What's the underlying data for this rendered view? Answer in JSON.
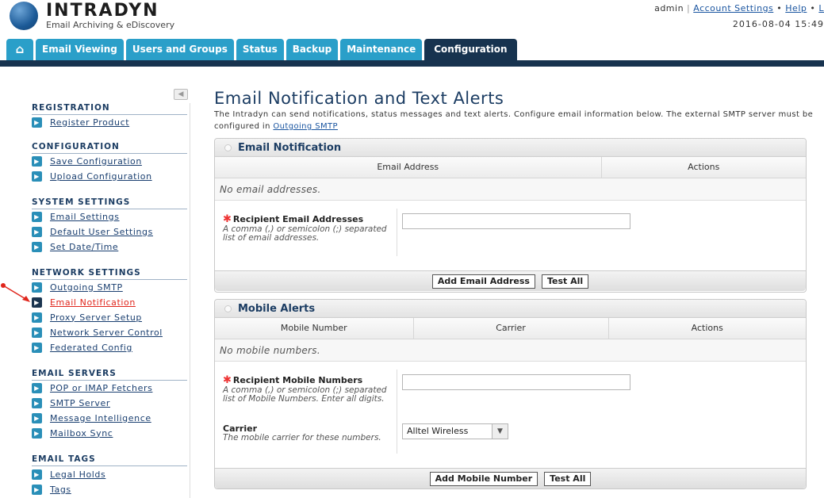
{
  "header": {
    "brand": "INTRADYN",
    "tagline": "Email Archiving & eDiscovery",
    "user": "admin",
    "account_settings": "Account Settings",
    "help": "Help",
    "logout": "L",
    "datetime": "2016-08-04 15:49"
  },
  "tabs": [
    {
      "label": "Email Viewing"
    },
    {
      "label": "Users and Groups"
    },
    {
      "label": "Status"
    },
    {
      "label": "Backup"
    },
    {
      "label": "Maintenance"
    },
    {
      "label": "Configuration"
    }
  ],
  "sidebar": {
    "sections": [
      {
        "title": "REGISTRATION",
        "items": [
          "Register Product"
        ]
      },
      {
        "title": "CONFIGURATION",
        "items": [
          "Save Configuration",
          "Upload Configuration"
        ]
      },
      {
        "title": "SYSTEM SETTINGS",
        "items": [
          "Email Settings",
          "Default User Settings",
          "Set Date/Time"
        ]
      },
      {
        "title": "NETWORK SETTINGS",
        "items": [
          "Outgoing SMTP",
          "Email Notification",
          "Proxy Server Setup",
          "Network Server Control",
          "Federated Config"
        ]
      },
      {
        "title": "EMAIL SERVERS",
        "items": [
          "POP or IMAP Fetchers",
          "SMTP Server",
          "Message Intelligence",
          "Mailbox Sync"
        ]
      },
      {
        "title": "EMAIL TAGS",
        "items": [
          "Legal Holds",
          "Tags"
        ]
      }
    ],
    "active_item": "Email Notification"
  },
  "main": {
    "title": "Email Notification and Text Alerts",
    "intro": "The Intradyn can send notifications, status messages and text alerts. Configure email information below. The external SMTP server must be configured in ",
    "intro_link": "Outgoing SMTP",
    "email_panel": {
      "title": "Email Notification",
      "columns": [
        "Email Address",
        "Actions"
      ],
      "empty_text": "No email addresses.",
      "field_label": "Recipient Email Addresses",
      "field_desc": "A comma (,) or semicolon (;) separated list of email addresses.",
      "field_value": "",
      "add_button": "Add Email Address",
      "test_button": "Test All"
    },
    "mobile_panel": {
      "title": "Mobile Alerts",
      "columns": [
        "Mobile Number",
        "Carrier",
        "Actions"
      ],
      "empty_text": "No mobile numbers.",
      "field_label": "Recipient Mobile Numbers",
      "field_desc": "A comma (,) or semicolon (;) separated list of Mobile Numbers. Enter all digits.",
      "field_value": "",
      "carrier_label": "Carrier",
      "carrier_desc": "The mobile carrier for these numbers.",
      "carrier_value": "Alltel Wireless",
      "add_button": "Add Mobile Number",
      "test_button": "Test All"
    }
  },
  "colors": {
    "nav_dark": "#17334f",
    "tab_blue": "#2a9fc9",
    "active_red": "#e0261c"
  },
  "icons": {
    "home": "home-icon",
    "collapse": "collapse-left-icon",
    "bullet": "arrow-right-icon"
  }
}
